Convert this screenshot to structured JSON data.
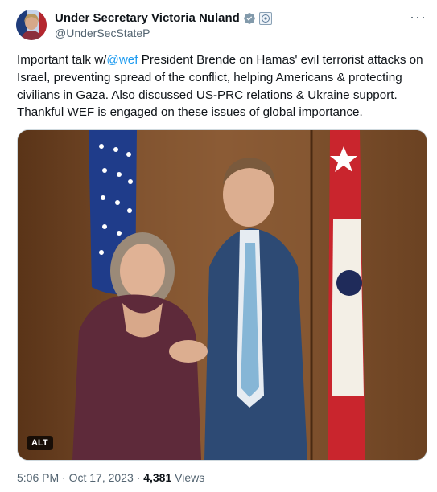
{
  "author": {
    "display_name": "Under Secretary Victoria Nuland",
    "handle": "@UnderSecStateP",
    "verified_icon": "verified-badge-icon",
    "affiliation_icon": "government-affiliation-icon"
  },
  "menu": {
    "more": "···"
  },
  "tweet": {
    "text_before": "Important talk w/",
    "mention": "@wef",
    "text_after": " President Brende on Hamas' evil terrorist attacks on Israel, preventing spread of the conflict, helping Americans & protecting civilians in Gaza. Also discussed US-PRC relations & Ukraine support. Thankful WEF is engaged on these issues of global importance."
  },
  "media": {
    "alt_label": "ALT"
  },
  "meta": {
    "time": "5:06 PM",
    "separator": "·",
    "date": "Oct 17, 2023",
    "views_count": "4,381",
    "views_label": "Views"
  },
  "colors": {
    "link": "#1d9bf0",
    "verified": "#829aab",
    "secondary_text": "#536471"
  }
}
